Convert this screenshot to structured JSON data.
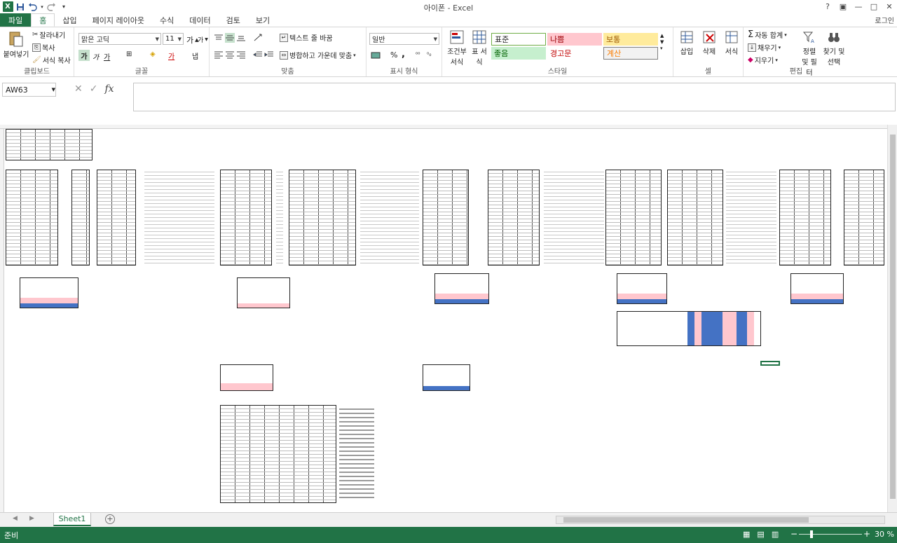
{
  "window": {
    "title": "아이폰 - Excel",
    "login": "로그인",
    "controls": {
      "help": "?",
      "restore_ribbon": "▣",
      "minimize": "—",
      "maximize": "□",
      "close": "✕"
    }
  },
  "qat": {
    "logo": "X",
    "save": "💾",
    "undo": "↶",
    "redo": "↷",
    "more": "▾"
  },
  "tabs": [
    {
      "label": "파일"
    },
    {
      "label": "홈"
    },
    {
      "label": "삽입"
    },
    {
      "label": "페이지 레이아웃"
    },
    {
      "label": "수식"
    },
    {
      "label": "데이터"
    },
    {
      "label": "검토"
    },
    {
      "label": "보기"
    }
  ],
  "ribbon": {
    "clipboard": {
      "label": "클립보드",
      "paste": "붙여넣기",
      "cut": "잘라내기",
      "copy": "복사",
      "format_painter": "서식 복사"
    },
    "font": {
      "label": "글꼴",
      "font_name": "맑은 고딕",
      "font_size": "11",
      "bold": "가",
      "italic": "가",
      "underline": "가",
      "grow": "가",
      "shrink": "가",
      "border": "⊞",
      "fill_color": "◈",
      "font_color": "가",
      "phonetic": "냅"
    },
    "alignment": {
      "label": "맞춤",
      "wrap_text": "텍스트 줄 바꿈",
      "merge_center": "병합하고 가운데 맞춤"
    },
    "number": {
      "label": "표시 형식",
      "format": "일반",
      "percent": "%",
      "comma": ","
    },
    "styles": {
      "label": "스타일",
      "cond_format": "조건부 서식",
      "table_format": "표 서식",
      "normal": "표준",
      "bad": "나쁨",
      "neutral": "보통",
      "good": "좋음",
      "warning": "경고문",
      "calc": "계산",
      "normal_color": "#ffffff",
      "bad_color": "#ffc7ce",
      "neutral_color": "#ffeb9c",
      "good_color": "#c6efce",
      "warning_color": "#ffffff",
      "calc_color": "#f2f2f2"
    },
    "cells": {
      "label": "셀",
      "insert": "삽입",
      "delete": "삭제",
      "format": "서식"
    },
    "editing": {
      "label": "편집",
      "autosum": "자동 합계",
      "fill": "채우기",
      "clear": "지우기",
      "sort_filter": "정렬 및 필터",
      "find_select": "찾기 및 선택"
    }
  },
  "formula_bar": {
    "name_box": "AW63",
    "cancel": "✕",
    "enter": "✓",
    "fx": "fx",
    "value": ""
  },
  "sheet_tabs": [
    {
      "label": "Sheet1"
    }
  ],
  "status": {
    "text": "준비",
    "zoom": "30 %",
    "zoom_minus": "−",
    "zoom_plus": "+"
  },
  "colors": {
    "accent": "#217346"
  }
}
